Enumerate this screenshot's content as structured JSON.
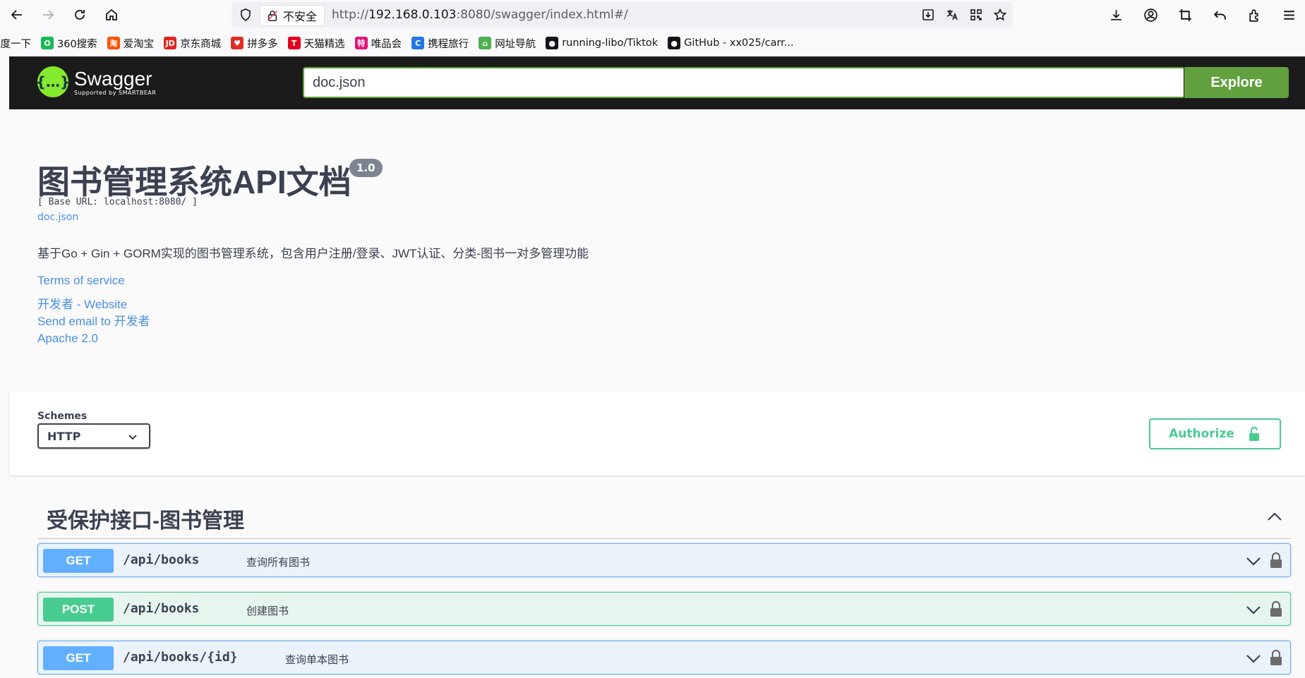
{
  "browser": {
    "insecure_label": "不安全",
    "url_prefix": "http://",
    "url_host": "192.168.0.103",
    "url_rest": ":8080/swagger/index.html#/",
    "bookmarks": [
      {
        "label": "百度一下",
        "color": "#2932e1",
        "glyph": ""
      },
      {
        "label": "360搜索",
        "color": "#19b955",
        "glyph": "O"
      },
      {
        "label": "爱淘宝",
        "color": "#ff5000",
        "glyph": "淘"
      },
      {
        "label": "京东商城",
        "color": "#e1251b",
        "glyph": "JD"
      },
      {
        "label": "拼多多",
        "color": "#e02e24",
        "glyph": "♥"
      },
      {
        "label": "天猫精选",
        "color": "#e2001a",
        "glyph": "T"
      },
      {
        "label": "唯品会",
        "color": "#e6127a",
        "glyph": "特"
      },
      {
        "label": "携程旅行",
        "color": "#2577e3",
        "glyph": "C"
      },
      {
        "label": "网址导航",
        "color": "#4caf50",
        "glyph": "⌂"
      },
      {
        "label": "running-libo/Tiktok",
        "color": "#15141a",
        "glyph": "●"
      },
      {
        "label": "GitHub - xx025/carr...",
        "color": "#15141a",
        "glyph": "●"
      }
    ]
  },
  "topbar": {
    "logo_title": "Swagger",
    "logo_sub": "Supported by SMARTBEAR",
    "url_value": "doc.json",
    "explore_label": "Explore",
    "accent": "#62a03f"
  },
  "info": {
    "title": "图书管理系统API文档",
    "version": "1.0",
    "base_url": "[ Base URL: localhost:8080/ ]",
    "doc_link": "doc.json",
    "description": "基于Go + Gin + GORM实现的图书管理系统，包含用户注册/登录、JWT认证、分类-图书一对多管理功能",
    "terms": "Terms of service",
    "website": "开发者 - Website",
    "email": "Send email to 开发者",
    "license": "Apache 2.0"
  },
  "schemes": {
    "label": "Schemes",
    "selected": "HTTP"
  },
  "authorize_label": "Authorize",
  "tag": {
    "title": "受保护接口-图书管理",
    "operations": [
      {
        "method": "GET",
        "path": "/api/books",
        "summary": "查询所有图书"
      },
      {
        "method": "POST",
        "path": "/api/books",
        "summary": "创建图书"
      },
      {
        "method": "GET",
        "path": "/api/books/{id}",
        "summary": "查询单本图书"
      }
    ]
  }
}
